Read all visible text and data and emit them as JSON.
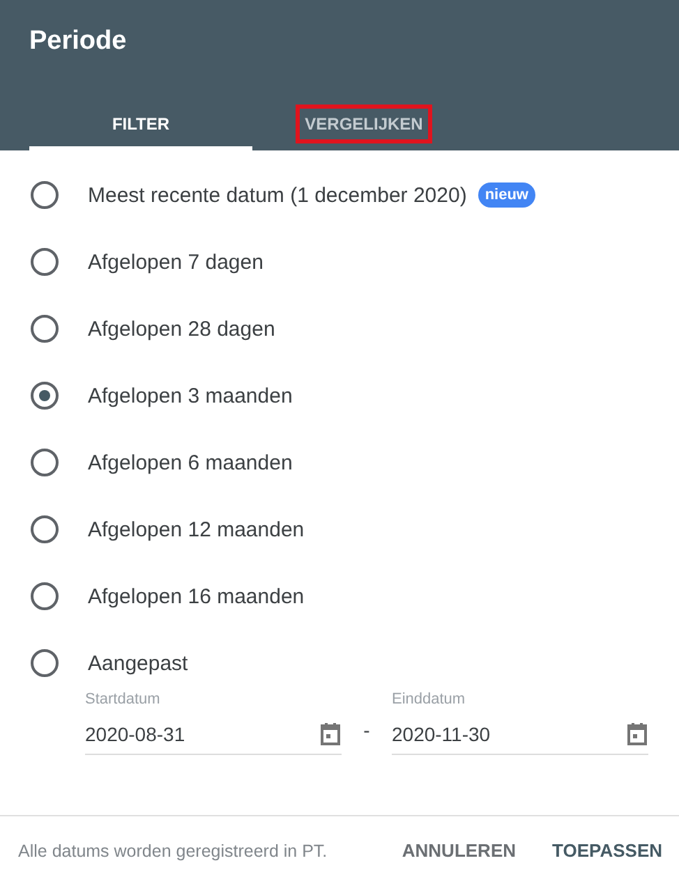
{
  "title": "Periode",
  "tabs": [
    {
      "label": "FILTER",
      "selected": true,
      "highlighted": false
    },
    {
      "label": "VERGELIJKEN",
      "selected": false,
      "highlighted": true
    }
  ],
  "options": [
    {
      "label": "Meest recente datum (1 december 2020)",
      "badge": "nieuw",
      "selected": false
    },
    {
      "label": "Afgelopen 7 dagen",
      "selected": false
    },
    {
      "label": "Afgelopen 28 dagen",
      "selected": false
    },
    {
      "label": "Afgelopen 3 maanden",
      "selected": true
    },
    {
      "label": "Afgelopen 6 maanden",
      "selected": false
    },
    {
      "label": "Afgelopen 12 maanden",
      "selected": false
    },
    {
      "label": "Afgelopen 16 maanden",
      "selected": false
    },
    {
      "label": "Aangepast",
      "selected": false
    }
  ],
  "date_range": {
    "start": {
      "label": "Startdatum",
      "value": "2020-08-31"
    },
    "separator": "-",
    "end": {
      "label": "Einddatum",
      "value": "2020-11-30"
    }
  },
  "footer": {
    "note": "Alle datums worden geregistreerd in PT.",
    "buttons": [
      {
        "label": "ANNULEREN",
        "kind": "secondary"
      },
      {
        "label": "TOEPASSEN",
        "kind": "primary"
      }
    ]
  }
}
